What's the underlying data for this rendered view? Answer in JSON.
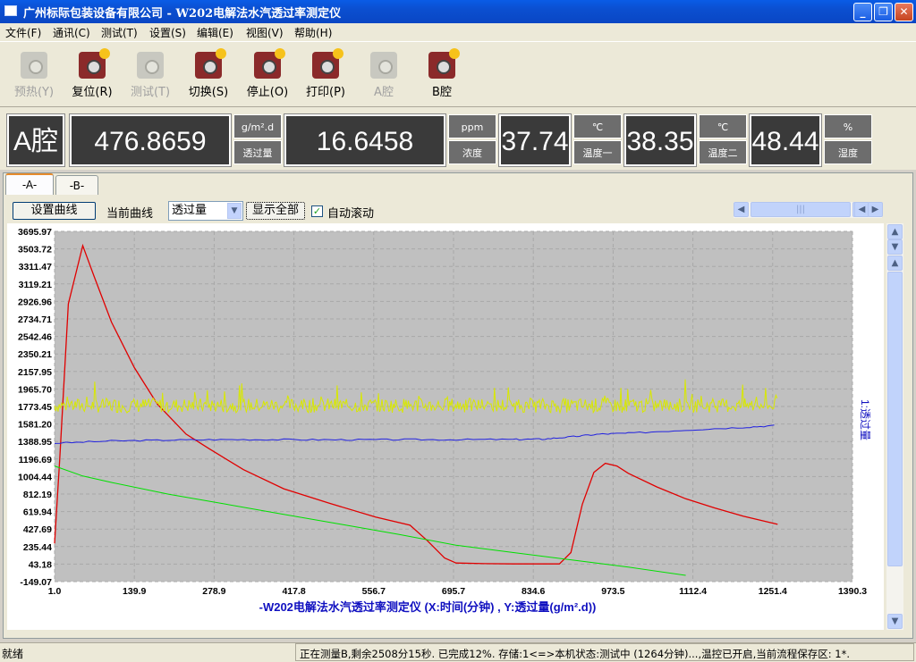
{
  "window": {
    "title": "广州标际包装设备有限公司 - W202电解法水汽透过率测定仪",
    "min_label": "_",
    "max_label": "❐",
    "close_label": "✕"
  },
  "menu": [
    "文件(F)",
    "通讯(C)",
    "测试(T)",
    "设置(S)",
    "编辑(E)",
    "视图(V)",
    "帮助(H)"
  ],
  "toolbar": [
    {
      "label": "预热(Y)",
      "enabled": false,
      "icon": "wrench-icon"
    },
    {
      "label": "复位(R)",
      "enabled": true,
      "icon": "gear-icon"
    },
    {
      "label": "测试(T)",
      "enabled": false,
      "icon": "wrench-icon"
    },
    {
      "label": "切换(S)",
      "enabled": true,
      "icon": "gear-icon"
    },
    {
      "label": "停止(O)",
      "enabled": true,
      "icon": "gear-icon"
    },
    {
      "label": "打印(P)",
      "enabled": true,
      "icon": "gear-icon"
    },
    {
      "label": "A腔",
      "enabled": false,
      "icon": "wrench-icon"
    },
    {
      "label": "B腔",
      "enabled": true,
      "icon": "gear-icon"
    }
  ],
  "readout": {
    "chamber": "A腔",
    "transmission_value": "476.8659",
    "transmission_unit": "g/m².d",
    "transmission_label": "透过量",
    "concentration_value": "16.6458",
    "concentration_unit": "ppm",
    "concentration_label": "浓度",
    "temp1_value": "37.74",
    "temp1_unit": "℃",
    "temp1_label": "温度一",
    "temp2_value": "38.35",
    "temp2_unit": "℃",
    "temp2_label": "温度二",
    "humidity_value": "48.44",
    "humidity_unit": "%",
    "humidity_label": "湿度"
  },
  "tabs": [
    {
      "label": "-A-",
      "active": true
    },
    {
      "label": "-B-",
      "active": false
    }
  ],
  "controls": {
    "set_curve_label": "设置曲线",
    "current_curve_label": "当前曲线",
    "current_curve_value": "透过量",
    "show_all_label": "显示全部",
    "auto_scroll_label": "自动滚动",
    "auto_scroll_checked": true,
    "scroll_thumb_label": "|||"
  },
  "chart_data": {
    "type": "line",
    "title": "-W202电解法水汽透过率测定仪 (X:时间(分钟) , Y:透过量(g/m².d))",
    "y_axis_side_label": "1:透过量",
    "xlim": [
      1.0,
      1390.3
    ],
    "ylim": [
      -149.07,
      3695.97
    ],
    "x_ticks": [
      "1.0",
      "139.9",
      "278.9",
      "417.8",
      "556.7",
      "695.7",
      "834.6",
      "973.5",
      "1112.4",
      "1251.4",
      "1390.3"
    ],
    "y_ticks": [
      "3695.97",
      "3503.72",
      "3311.47",
      "3119.21",
      "2926.96",
      "2734.71",
      "2542.46",
      "2350.21",
      "2157.95",
      "1965.70",
      "1773.45",
      "1581.20",
      "1388.95",
      "1196.69",
      "1004.44",
      "812.19",
      "619.94",
      "427.69",
      "235.44",
      "43.18",
      "-149.07"
    ],
    "grid": true,
    "series": [
      {
        "color": "#e00000",
        "x": [
          1,
          10,
          25,
          50,
          70,
          100,
          140,
          180,
          230,
          270,
          330,
          400,
          480,
          560,
          620,
          650,
          680,
          700,
          750,
          800,
          880,
          900,
          920,
          940,
          960,
          980,
          1000,
          1050,
          1100,
          1150,
          1200,
          1260
        ],
        "values": [
          270,
          1200,
          2900,
          3540,
          3200,
          2700,
          2200,
          1800,
          1470,
          1310,
          1080,
          870,
          710,
          560,
          470,
          300,
          110,
          55,
          48,
          45,
          45,
          170,
          700,
          1050,
          1150,
          1120,
          1040,
          890,
          760,
          660,
          570,
          480
        ]
      },
      {
        "color": "#d8e800",
        "x": [
          1,
          100,
          200,
          300,
          400,
          500,
          600,
          700,
          800,
          900,
          1000,
          1100,
          1200,
          1260
        ],
        "values": [
          1780,
          1790,
          1785,
          1790,
          1780,
          1785,
          1790,
          1780,
          1785,
          1790,
          1780,
          1785,
          1790,
          1785
        ]
      },
      {
        "color": "#2020e0",
        "x": [
          1,
          100,
          200,
          300,
          400,
          500,
          600,
          700,
          800,
          850,
          900,
          950,
          1000,
          1100,
          1200,
          1260
        ],
        "values": [
          1370,
          1395,
          1405,
          1410,
          1410,
          1408,
          1410,
          1410,
          1412,
          1415,
          1440,
          1470,
          1480,
          1515,
          1545,
          1565
        ]
      },
      {
        "color": "#00e000",
        "x": [
          1,
          50,
          100,
          200,
          300,
          400,
          500,
          600,
          700,
          800,
          900,
          1000,
          1100
        ],
        "values": [
          1120,
          1010,
          940,
          810,
          700,
          590,
          480,
          370,
          250,
          170,
          90,
          10,
          -80
        ]
      }
    ]
  },
  "status": {
    "left": "就绪",
    "right": "正在测量B,剩余2508分15秒. 已完成12%. 存储:1<=>本机状态:测试中 (1264分钟)...,温控已开启,当前流程保存区: 1*."
  }
}
